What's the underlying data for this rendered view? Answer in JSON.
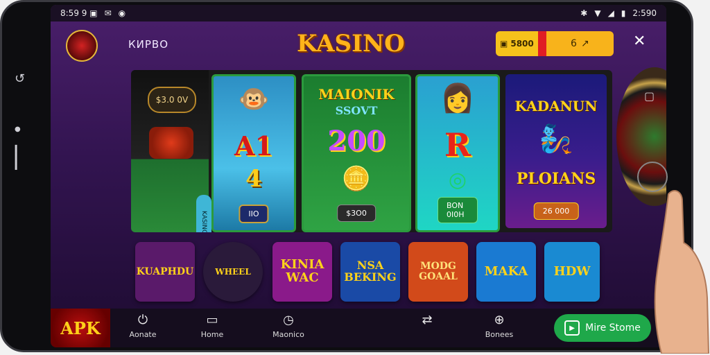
{
  "status": {
    "left": "8:59 9 ▣",
    "right": "2:590"
  },
  "header": {
    "logo_badge": "",
    "brand_small": "КИРВО",
    "title": "KASINO",
    "wallet_amount": "5800",
    "wallet_extra": "6"
  },
  "banner": {
    "left_pill": "$3.0 0V",
    "side_tab": "KASINO",
    "reel1": {
      "top": "",
      "mid": "A1",
      "low": "4",
      "btn": "IIO"
    },
    "reel2": {
      "line1": "MAIONIK",
      "line2": "SSOVT",
      "big": "200",
      "btn": "$3O0"
    },
    "reel3": {
      "mid": "R",
      "btn": "BON 0I0H"
    },
    "reel4": {
      "line1": "KADANUN",
      "line2": "PLOIANS",
      "btn": "26 000"
    }
  },
  "games": [
    {
      "label": "KUAPHDU",
      "bg": "#5a1a6a",
      "fg": "#ffd21a"
    },
    {
      "label": "WHEEL",
      "bg": "#2a1a3a",
      "fg": "#ffd21a"
    },
    {
      "label": "KINIA WAC",
      "bg": "#8a1a8a",
      "fg": "#ffd21a"
    },
    {
      "label": "NSA BEKING",
      "bg": "#1a4aa6",
      "fg": "#ffd21a"
    },
    {
      "label": "MODG GOAAL",
      "bg": "#d24a1a",
      "fg": "#ffe27a"
    },
    {
      "label": "MAKA",
      "bg": "#1a7ad2",
      "fg": "#ffd21a"
    },
    {
      "label": "HDW",
      "bg": "#1a8ad2",
      "fg": "#ffd21a"
    }
  ],
  "nav": {
    "apk": "APK",
    "items": [
      "Aоnate",
      "Home",
      "Maonico",
      "Bonees"
    ],
    "store": "Mire Stome"
  },
  "colors": {
    "accent": "#ffb31a",
    "store_green": "#1fa84a",
    "bg_purple": "#321450"
  }
}
